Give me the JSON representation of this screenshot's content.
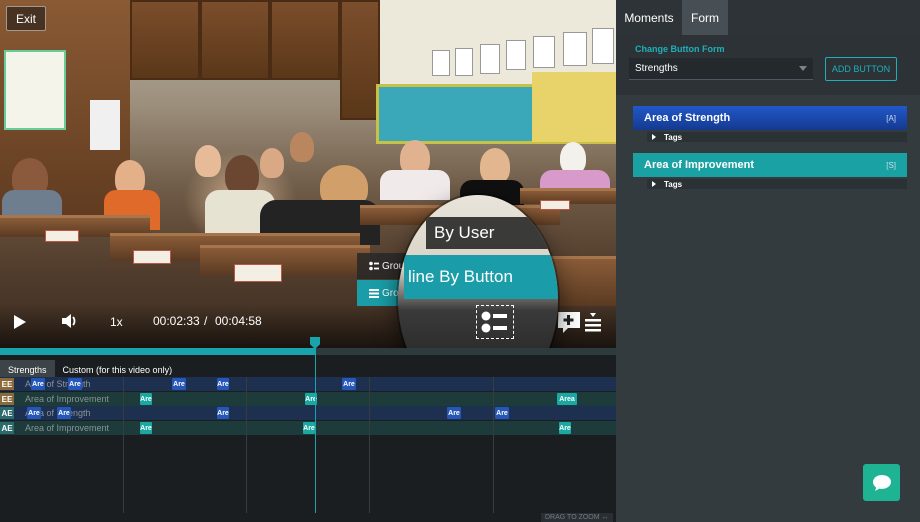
{
  "video": {
    "exit_label": "Exit",
    "speed": "1x",
    "current_time": "00:02:33",
    "time_separator": "/",
    "duration": "00:04:58",
    "playback_progress": 0.51
  },
  "view_menu": {
    "item_user": "Grou",
    "item_button": "Gro",
    "magnified_user": "By User",
    "magnified_button": "line By Button"
  },
  "timeline": {
    "tabs": [
      "Strengths",
      "Custom (for this video only)"
    ],
    "rows": [
      {
        "code": "EE",
        "label": "Area of Strength",
        "kind": "strength",
        "code_color": "#8a6a3a",
        "marker_label": "Are"
      },
      {
        "code": "EE",
        "label": "Area of Improvement",
        "kind": "improve",
        "code_color": "#8a6a3a",
        "marker_label": "Are"
      },
      {
        "code": "AE",
        "label": "Area of Strength",
        "kind": "strength",
        "code_color": "#2c6b6b",
        "marker_label": "Are"
      },
      {
        "code": "AE",
        "label": "Area of Improvement",
        "kind": "improve",
        "code_color": "#2c6b6b",
        "marker_label": "Are"
      }
    ],
    "wide_marker_label": "Area",
    "drag_to_zoom": "DRAG TO ZOOM"
  },
  "panel": {
    "tabs": {
      "moments": "Moments",
      "form": "Form"
    },
    "change_form_label": "Change Button Form",
    "form_value": "Strengths",
    "add_button_label": "ADD BUTTON",
    "buttons": [
      {
        "label": "Area of Strength",
        "key": "[A]",
        "tags": "Tags"
      },
      {
        "label": "Area of Improvement",
        "key": "[S]",
        "tags": "Tags"
      }
    ]
  },
  "colors": {
    "accent": "#1eb0ba",
    "strength": "#2158c9",
    "improvement": "#1aa1a3",
    "chat": "#1eb393"
  },
  "icons": {
    "play": "play-icon",
    "volume": "volume-icon",
    "add_moment": "add-moment-icon",
    "list_view": "list-view-icon",
    "chat": "chat-icon"
  }
}
